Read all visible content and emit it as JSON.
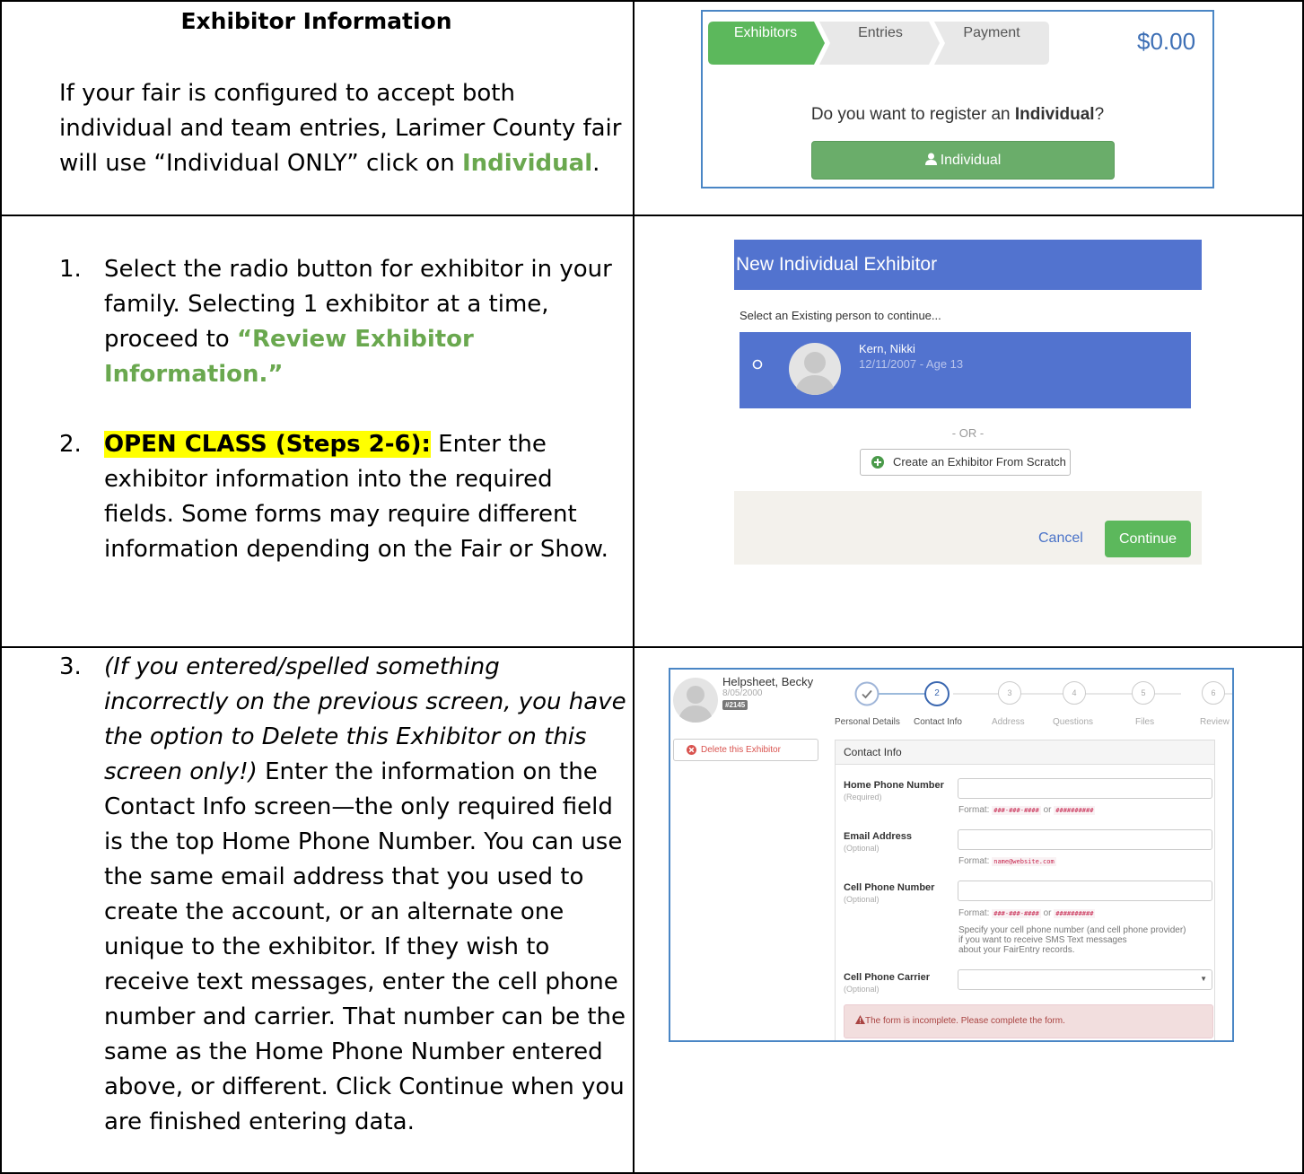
{
  "row1": {
    "heading": "Exhibitor Information",
    "text_before": "If your fair is configured to accept both individual and team entries, Larimer County fair will use “Individual ONLY” click on ",
    "text_link": "Individual",
    "text_after": "."
  },
  "row2": {
    "item1_num": "1.",
    "item1_text": "Select the radio button for exhibitor in your family. Selecting 1 exhibitor at a time, proceed to ",
    "item1_link": "“Review Exhibitor Information.”",
    "item2_num": "2.",
    "item2_highlight": "OPEN CLASS (Steps 2-6):",
    "item2_text": " Enter the exhibitor information into the required fields. Some forms may require different information depending on the Fair or Show."
  },
  "row3": {
    "item_num": "3.",
    "italic_text": "(If you entered/spelled something incorrectly on the previous screen, you have the option to Delete this Exhibitor on this screen only!)",
    "text": " Enter the information on the Contact Info screen—the only required field is the top Home Phone Number. You can use the same email address that you used to create the account, or an alternate one unique to the exhibitor. If they wish to receive text messages, enter the cell phone number and carrier. That number can be the same as the Home Phone Number entered above, or different. Click Continue when you are finished entering data."
  },
  "panel1": {
    "steps": [
      "Exhibitors",
      "Entries",
      "Payment"
    ],
    "total": "$0.00",
    "question_before": "Do you want to register an ",
    "question_bold": "Individual",
    "question_after": "?",
    "button_label": "Individual",
    "colors": {
      "active_step": "#5cb85c",
      "inactive_step": "#e8e8e8",
      "button": "#6aad6a"
    }
  },
  "panel2": {
    "title": "New Individual Exhibitor",
    "select_text": "Select an Existing person to continue...",
    "person_name": "Kern, Nikki",
    "person_meta": "12/11/2007 - Age 13",
    "or_text": "- OR -",
    "scratch_button": "Create an Exhibitor From Scratch",
    "cancel": "Cancel",
    "continue": "Continue",
    "colors": {
      "header": "#5273cf",
      "continue": "#5cb85c"
    }
  },
  "panel3": {
    "exhibitor_name": "Helpsheet, Becky",
    "exhibitor_dob": "8/05/2000",
    "exhibitor_id": "#2145",
    "delete_button": "Delete this Exhibitor",
    "wizard": [
      {
        "num": "✓",
        "label": "Personal Details"
      },
      {
        "num": "2",
        "label": "Contact Info"
      },
      {
        "num": "3",
        "label": "Address"
      },
      {
        "num": "4",
        "label": "Questions"
      },
      {
        "num": "5",
        "label": "Files"
      },
      {
        "num": "6",
        "label": "Review"
      }
    ],
    "section_title": "Contact Info",
    "home_phone_label": "Home Phone Number",
    "home_phone_req": "(Required)",
    "email_label": "Email Address",
    "email_req": "(Optional)",
    "cell_label": "Cell Phone Number",
    "cell_req": "(Optional)",
    "carrier_label": "Cell Phone Carrier",
    "carrier_req": "(Optional)",
    "format_word": "Format:",
    "phone_format_a": "###-###-####",
    "or_word": "or",
    "phone_format_b": "##########",
    "email_format": "name@website.com",
    "cell_help_1": "Specify your cell phone number (and cell phone provider)",
    "cell_help_2": "if you want to receive SMS Text messages",
    "cell_help_3": "about your FairEntry records.",
    "alert": "The form is incomplete. Please complete the form."
  }
}
